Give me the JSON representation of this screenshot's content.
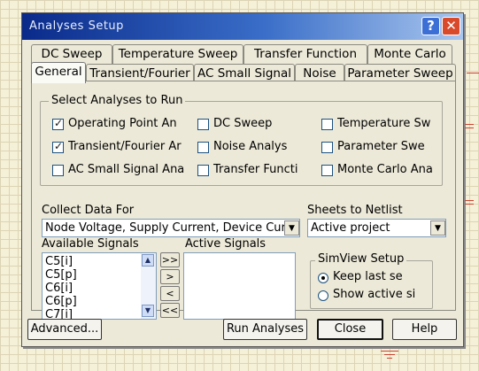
{
  "window": {
    "title": "Analyses Setup",
    "help_glyph": "?",
    "close_glyph": "✕"
  },
  "tabs_back": [
    "DC Sweep",
    "Temperature Sweep",
    "Transfer Function",
    "Monte Carlo"
  ],
  "tabs_front": [
    "General",
    "Transient/Fourier",
    "AC Small Signal",
    "Noise",
    "Parameter Sweep"
  ],
  "select_analyses": {
    "legend": "Select Analyses to Run",
    "items": [
      {
        "label": "Operating Point An",
        "checked": true
      },
      {
        "label": "DC Sweep",
        "checked": false
      },
      {
        "label": "Temperature Sw",
        "checked": false
      },
      {
        "label": "Transient/Fourier Ar",
        "checked": true
      },
      {
        "label": "Noise Analys",
        "checked": false
      },
      {
        "label": "Parameter Swe",
        "checked": false
      },
      {
        "label": "AC Small Signal Ana",
        "checked": false
      },
      {
        "label": "Transfer Functi",
        "checked": false
      },
      {
        "label": "Monte Carlo Ana",
        "checked": false
      }
    ]
  },
  "collect": {
    "label": "Collect Data For",
    "value": "Node Voltage, Supply Current, Device Cur"
  },
  "sheets": {
    "label": "Sheets to Netlist",
    "value": "Active project"
  },
  "available": {
    "label": "Available Signals",
    "items": [
      "C5[i]",
      "C5[p]",
      "C6[i]",
      "C6[p]",
      "C7[i]"
    ]
  },
  "active": {
    "label": "Active Signals"
  },
  "move_buttons": [
    ">>",
    ">",
    "<",
    "<<"
  ],
  "simview": {
    "legend": "SimView Setup",
    "options": [
      "Keep last se",
      "Show active si"
    ],
    "selected": 0
  },
  "footer": {
    "advanced": "Advanced...",
    "run": "Run Analyses",
    "close": "Close",
    "help": "Help"
  }
}
